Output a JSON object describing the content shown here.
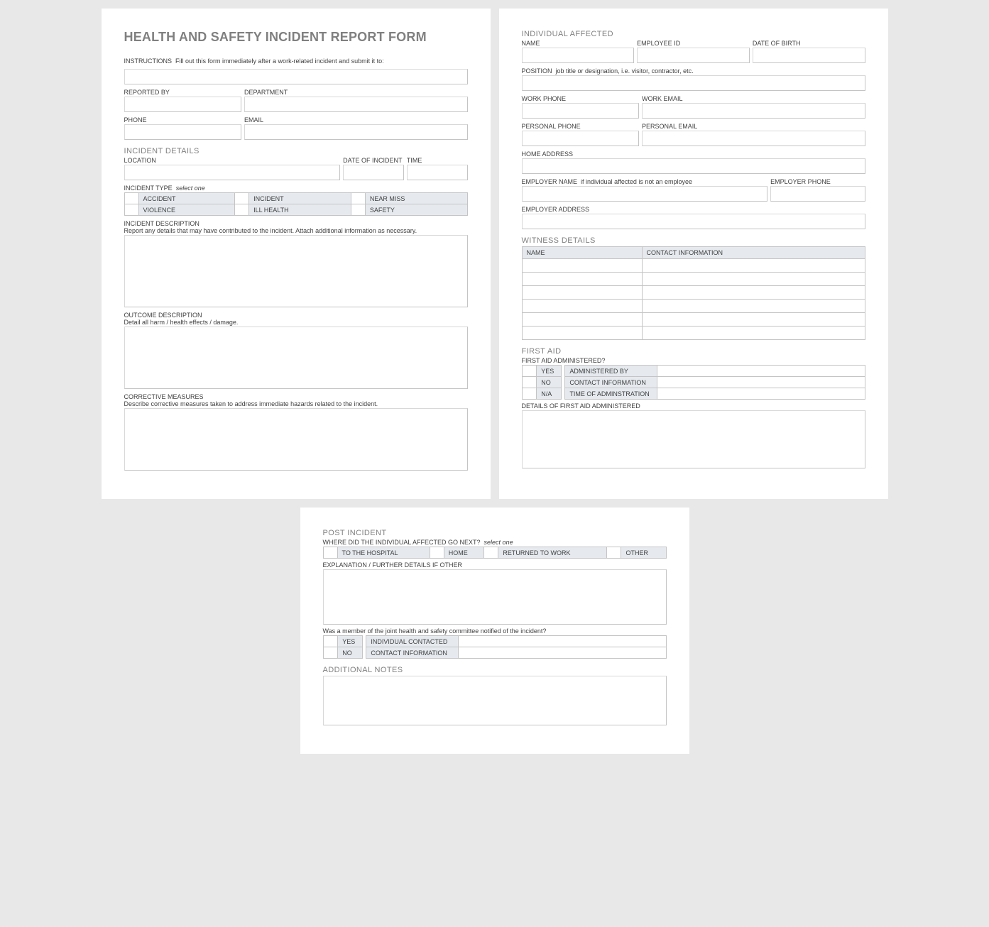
{
  "form": {
    "title": "HEALTH AND SAFETY INCIDENT REPORT FORM",
    "instructionsLabel": "INSTRUCTIONS",
    "instructionsHint": "Fill out this form immediately after a work-related incident and submit it to:",
    "reportedBy": "REPORTED BY",
    "department": "DEPARTMENT",
    "phone": "PHONE",
    "email": "EMAIL",
    "incidentDetails": "INCIDENT DETAILS",
    "location": "LOCATION",
    "dateOfIncident": "DATE OF INCIDENT",
    "time": "TIME",
    "incidentType": "INCIDENT TYPE",
    "selectOne": "select one",
    "types": [
      "ACCIDENT",
      "INCIDENT",
      "NEAR MISS",
      "VIOLENCE",
      "ILL HEALTH",
      "SAFETY"
    ],
    "incidentDescription": "INCIDENT DESCRIPTION",
    "incidentDescriptionSub": "Report any details that may have contributed to the incident.  Attach additional information as necessary.",
    "outcomeDescription": "OUTCOME DESCRIPTION",
    "outcomeDescriptionSub": "Detail all harm / health effects / damage.",
    "correctiveMeasures": "CORRECTIVE MEASURES",
    "correctiveMeasuresSub": "Describe corrective measures taken to address immediate hazards related to the incident."
  },
  "individual": {
    "heading": "INDIVIDUAL AFFECTED",
    "name": "NAME",
    "employeeId": "EMPLOYEE ID",
    "dob": "DATE OF BIRTH",
    "positionLabel": "POSITION",
    "positionHint": "job title or designation, i.e. visitor, contractor, etc.",
    "workPhone": "WORK PHONE",
    "workEmail": "WORK EMAIL",
    "personalPhone": "PERSONAL PHONE",
    "personalEmail": "PERSONAL EMAIL",
    "homeAddress": "HOME ADDRESS",
    "employerNameLabel": "EMPLOYER NAME",
    "employerNameHint": "if individual affected is not an employee",
    "employerPhone": "EMPLOYER PHONE",
    "employerAddress": "EMPLOYER ADDRESS"
  },
  "witness": {
    "heading": "WITNESS DETAILS",
    "colName": "NAME",
    "colContact": "CONTACT INFORMATION",
    "rows": 6
  },
  "firstAid": {
    "heading": "FIRST AID",
    "administeredQ": "FIRST AID ADMINISTERED?",
    "opts": [
      "YES",
      "NO",
      "N/A"
    ],
    "adminBy": "ADMINISTERED BY",
    "contactInfo": "CONTACT INFORMATION",
    "timeOfAdmin": "TIME OF ADMINSTRATION",
    "details": "DETAILS OF FIRST AID ADMINISTERED"
  },
  "post": {
    "heading": "POST INCIDENT",
    "whereQ": "WHERE DID THE INDIVIDUAL AFFECTED GO NEXT?",
    "selectOne": "select one",
    "opts": [
      "TO THE HOSPITAL",
      "HOME",
      "RETURNED TO WORK",
      "OTHER"
    ],
    "explanation": "EXPLANATION / FURTHER DETAILS IF OTHER",
    "committeeQ": "Was a member of the joint health and safety committee notified of the incident?",
    "yes": "YES",
    "no": "NO",
    "individualContacted": "INDIVIDUAL CONTACTED",
    "contactInfo": "CONTACT INFORMATION",
    "additionalNotes": "ADDITIONAL NOTES"
  }
}
